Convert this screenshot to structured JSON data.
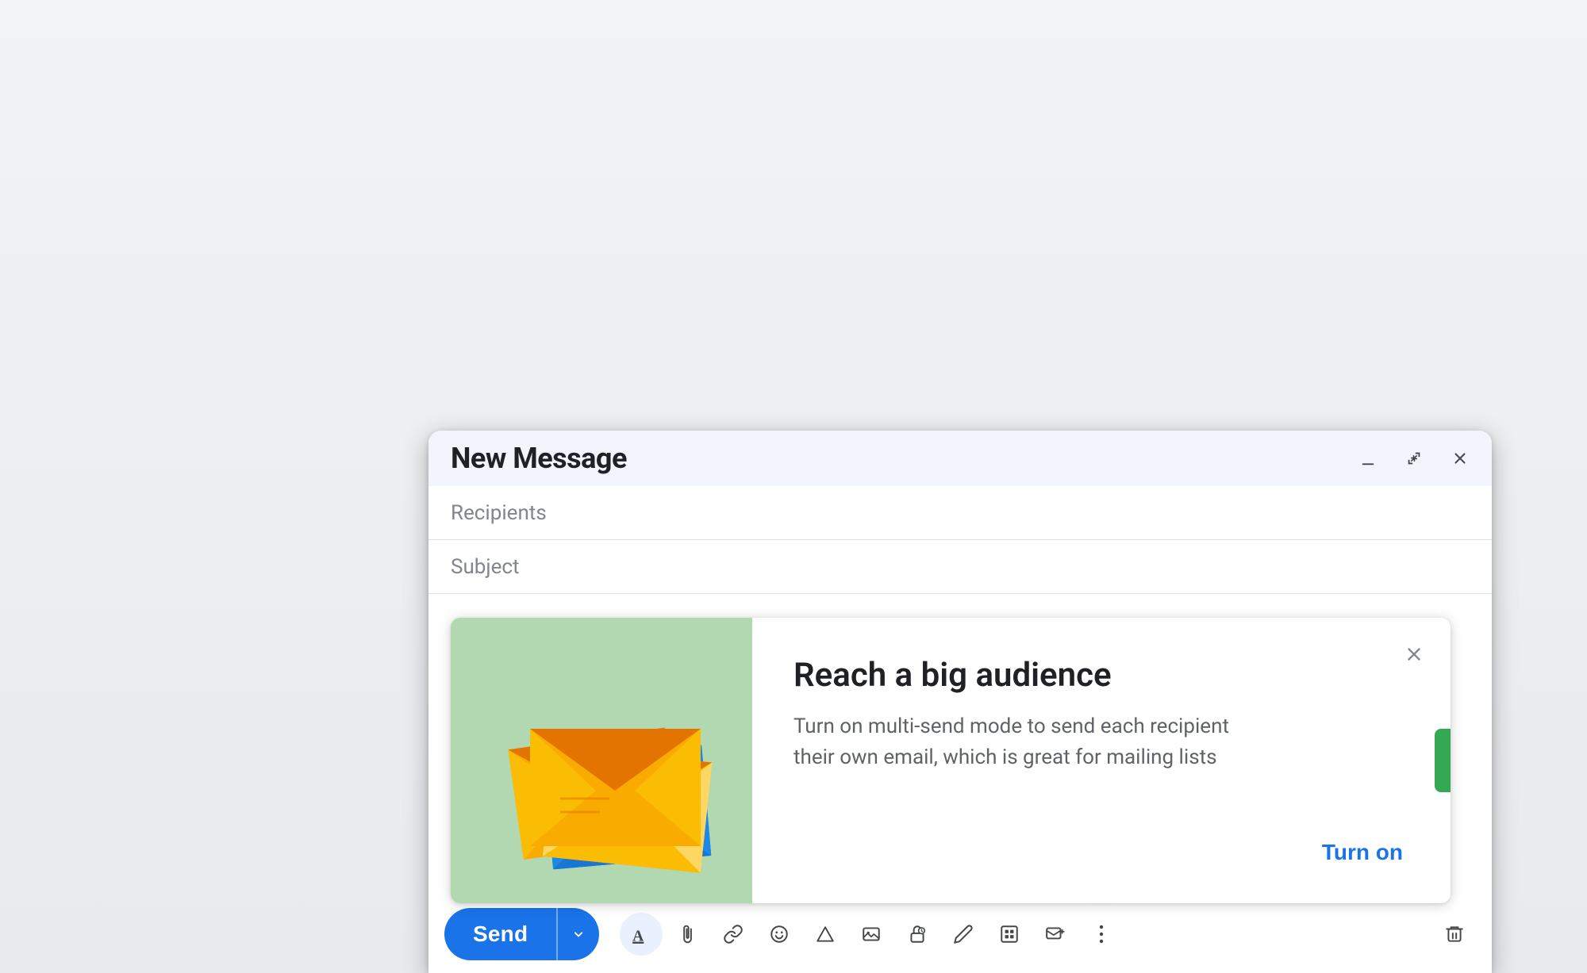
{
  "compose": {
    "title": "New Message",
    "recipients_placeholder": "Recipients",
    "subject_placeholder": "Subject",
    "body_placeholder": "",
    "dash_text": "--",
    "send_label": "Send",
    "send_dropdown_icon": "▾"
  },
  "header_actions": {
    "minimize_icon": "minimize-icon",
    "expand_icon": "expand-icon",
    "close_icon": "close-icon"
  },
  "promo": {
    "title": "Reach a big audience",
    "description": "Turn on multi-send mode to send each recipient their own email, which is great for mailing lists",
    "turn_on_label": "Turn on"
  },
  "toolbar": {
    "formatting_icon": "A",
    "attach_icon": "📎",
    "link_icon": "🔗",
    "emoji_icon": "😊",
    "drive_icon": "△",
    "photo_icon": "🖼",
    "lock_icon": "🔒",
    "pen_icon": "✏",
    "templates_icon": "⊡",
    "multi_send_icon": "✉",
    "more_icon": "⋮",
    "delete_icon": "🗑"
  }
}
